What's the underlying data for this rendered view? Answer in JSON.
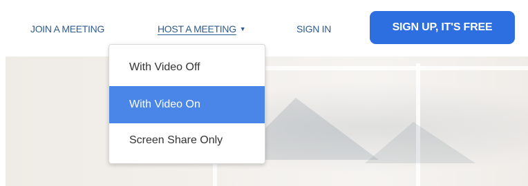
{
  "nav": {
    "join_label": "JOIN A MEETING",
    "host_label": "HOST A MEETING",
    "signin_label": "SIGN IN",
    "signup_label": "SIGN UP, IT'S FREE",
    "link_color": "#2d5b8f",
    "button_color": "#2d6ee0"
  },
  "host_dropdown": {
    "items": [
      {
        "label": "With Video Off",
        "highlighted": false
      },
      {
        "label": "With Video On",
        "highlighted": true
      },
      {
        "label": "Screen Share Only",
        "highlighted": false
      }
    ],
    "highlight_color": "#4a86e8"
  }
}
